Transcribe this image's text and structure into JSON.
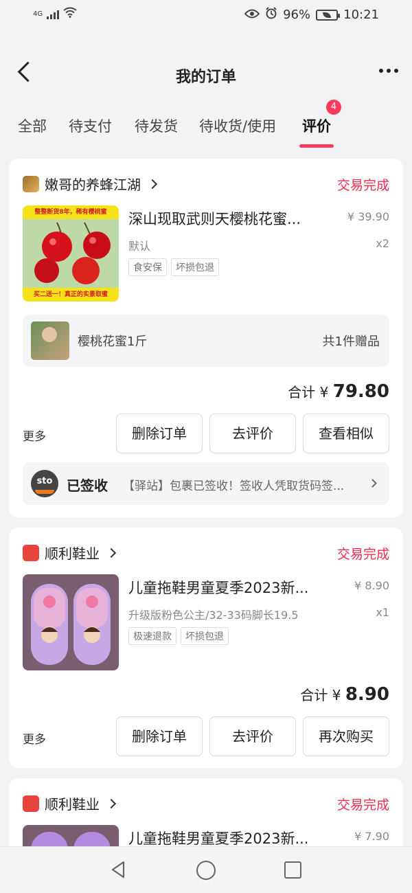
{
  "status_bar": {
    "network": "4G",
    "battery": "96%",
    "time": "10:21"
  },
  "header": {
    "title": "我的订单"
  },
  "tabs": [
    {
      "label": "全部"
    },
    {
      "label": "待支付"
    },
    {
      "label": "待发货"
    },
    {
      "label": "待收货/使用"
    },
    {
      "label": "评价",
      "badge": "4",
      "active": true
    }
  ],
  "orders": [
    {
      "shop": "嫩哥的养蜂江湖",
      "status": "交易完成",
      "product": {
        "title": "深山现取武则天樱桃花蜜...",
        "price": "¥ 39.90",
        "spec": "默认",
        "qty": "x2",
        "tags": [
          "食安保",
          "坏损包退"
        ],
        "thumb_top_text": "整整断货8年，稀有樱桃蜜",
        "thumb_bottom_text": "买二送一！真正的实景取蜜"
      },
      "gift": {
        "name": "樱桃花蜜1斤",
        "count": "共1件赠品"
      },
      "total_label": "合计 ¥",
      "total": "79.80",
      "more": "更多",
      "buttons": [
        "删除订单",
        "去评价",
        "查看相似"
      ],
      "logistics": {
        "carrier": "sto",
        "status": "已签收",
        "text": "【驿站】包裹已签收！签收人凭取货码签..."
      }
    },
    {
      "shop": "顺利鞋业",
      "status": "交易完成",
      "product": {
        "title": "儿童拖鞋男童夏季2023新...",
        "price": "¥ 8.90",
        "spec": "升级版粉色公主/32-33码脚长19.5",
        "qty": "x1",
        "tags": [
          "极速退款",
          "坏损包退"
        ]
      },
      "total_label": "合计 ¥",
      "total": "8.90",
      "more": "更多",
      "buttons": [
        "删除订单",
        "去评价",
        "再次购买"
      ]
    },
    {
      "shop": "顺利鞋业",
      "status": "交易完成",
      "product": {
        "title": "儿童拖鞋男童夏季2023新...",
        "price": "¥ 7.90"
      }
    }
  ],
  "colors": {
    "accent": "#ee2c4d",
    "badge": "#ff3b5c"
  }
}
